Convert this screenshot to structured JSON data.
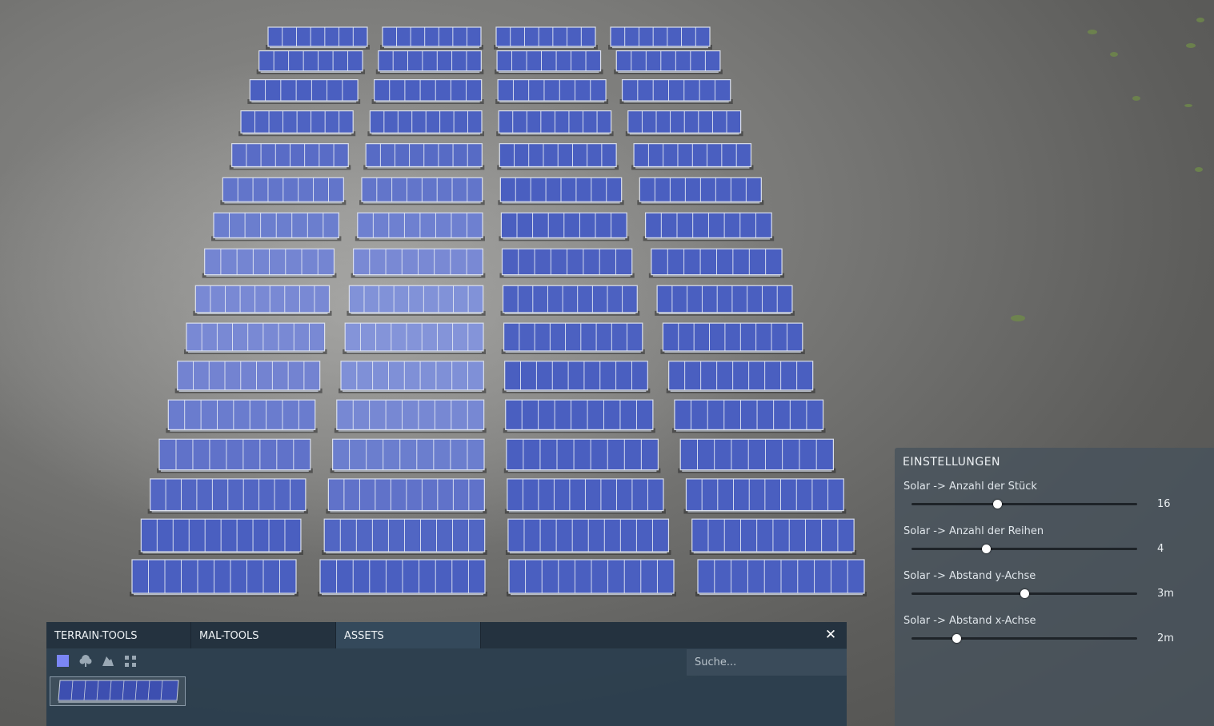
{
  "settings": {
    "title": "EINSTELLUNGEN",
    "items": [
      {
        "label": "Solar -> Anzahl der Stück",
        "value": "16",
        "slider_fraction": 0.38
      },
      {
        "label": "Solar -> Anzahl der Reihen",
        "value": "4",
        "slider_fraction": 0.33
      },
      {
        "label": "Solar -> Abstand y-Achse",
        "value": "3m",
        "slider_fraction": 0.5
      },
      {
        "label": "Solar -> Abstand x-Achse",
        "value": "2m",
        "slider_fraction": 0.2
      }
    ]
  },
  "tool_panel": {
    "tabs": [
      {
        "label": "TERRAIN-TOOLS",
        "active": false
      },
      {
        "label": "MAL-TOOLS",
        "active": false
      },
      {
        "label": "ASSETS",
        "active": true
      }
    ],
    "close_icon": "close-icon",
    "category_icons": [
      "square-icon",
      "tree-icon",
      "rock-icon",
      "scatter-icon"
    ],
    "search": {
      "placeholder": "Suche...",
      "value": ""
    },
    "assets": [
      {
        "name": "solar-panel-asset-icon"
      }
    ]
  },
  "colors": {
    "panel_blue": "#4a5fc0",
    "selected_category": "#7b86f5",
    "terrain": "#7a7a78"
  }
}
